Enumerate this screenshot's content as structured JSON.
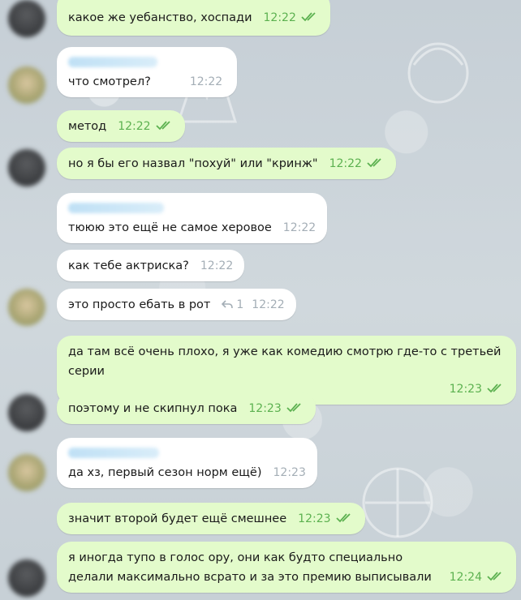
{
  "messages": [
    {
      "side": "out",
      "text": "какое же уебанство, хоспади",
      "time": "12:22",
      "read": true
    },
    {
      "side": "in",
      "sender_hidden": true,
      "text": "что смотрел?",
      "time": "12:22"
    },
    {
      "side": "out",
      "text": "метод",
      "time": "12:22",
      "read": true
    },
    {
      "side": "out",
      "text": "но я бы его назвал \"похуй\" или \"кринж\"",
      "time": "12:22",
      "read": true
    },
    {
      "side": "in",
      "sender_hidden": true,
      "text": "тююю это ещё не самое херовое",
      "time": "12:22"
    },
    {
      "side": "in",
      "text": "как тебе актриска?",
      "time": "12:22"
    },
    {
      "side": "in",
      "text": "это просто ебать в рот",
      "replies": "1",
      "time": "12:22"
    },
    {
      "side": "out",
      "text": "да там всё очень плохо, я уже как комедию смотрю где-то с третьей серии",
      "time": "12:23",
      "read": true
    },
    {
      "side": "out",
      "text": "поэтому и не скипнул пока",
      "time": "12:23",
      "read": true
    },
    {
      "side": "in",
      "sender_hidden": true,
      "text": "да хз, первый сезон норм ещё)",
      "time": "12:23"
    },
    {
      "side": "out",
      "text": "значит второй будет ещё смешнее",
      "time": "12:23",
      "read": true
    },
    {
      "side": "out",
      "text": "я иногда тупо в голос ору, они как будто специально делали максимально всрато и за это премию выписывали",
      "time": "12:24",
      "read": true
    }
  ],
  "colors": {
    "outgoing_bubble": "#e3fbcb",
    "incoming_bubble": "#ffffff",
    "outgoing_meta": "#5cb150",
    "incoming_meta": "#a4aeb6",
    "chat_background": "#c9d3da"
  },
  "icons": {
    "read_status": "double-check-icon",
    "reply": "reply-arrow-icon"
  }
}
